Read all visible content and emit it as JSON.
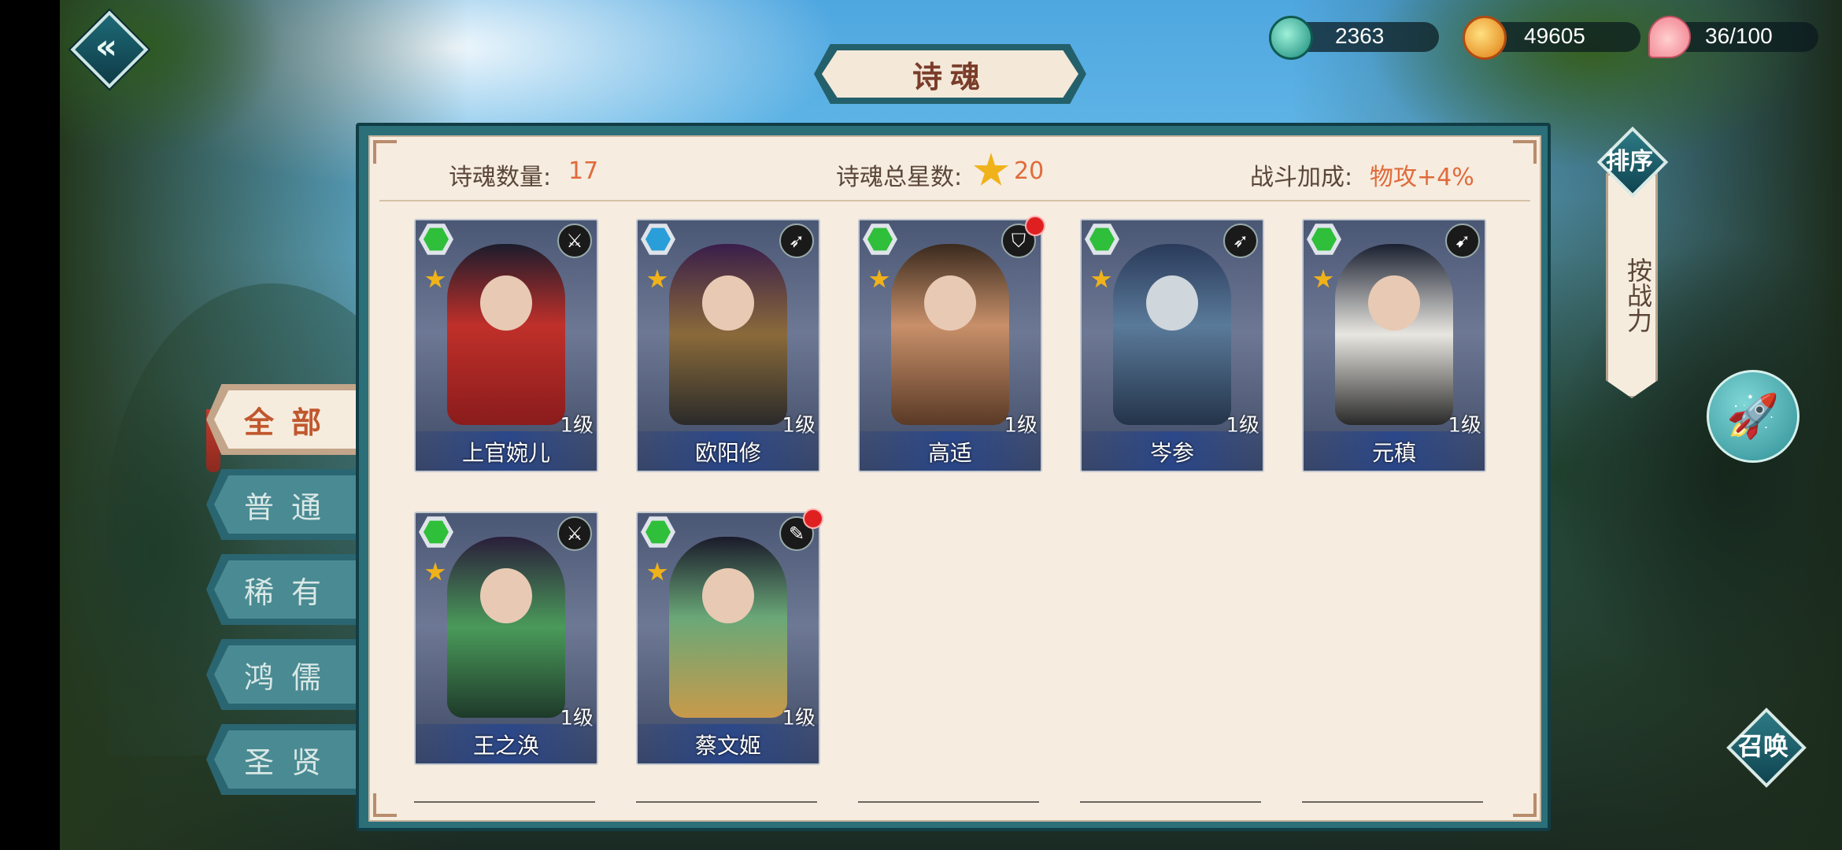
{
  "header": {
    "title": "诗魂",
    "back_icon": "chevron-left-icon",
    "resources": [
      {
        "name": "jade",
        "icon": "jade-orb-icon",
        "color": "#2fb6a0",
        "value": "2363"
      },
      {
        "name": "gold",
        "icon": "gold-coin-icon",
        "color": "#f0a020",
        "value": "49605"
      },
      {
        "name": "stamina",
        "icon": "peach-icon",
        "color": "#f2a0a8",
        "value": "36/100"
      }
    ]
  },
  "stats": {
    "count_label": "诗魂数量:",
    "count_value": "17",
    "stars_label": "诗魂总星数:",
    "stars_value": "20",
    "bonus_label": "战斗加成:",
    "bonus_value": "物攻+4%"
  },
  "tabs": [
    {
      "label": "全部",
      "active": true
    },
    {
      "label": "普通",
      "active": false
    },
    {
      "label": "稀有",
      "active": false
    },
    {
      "label": "鸿儒",
      "active": false
    },
    {
      "label": "圣贤",
      "active": false
    }
  ],
  "cards": [
    {
      "name": "上官婉儿",
      "level": "1级",
      "gem": "green",
      "class_icon": "dagger-icon",
      "red_dot": false
    },
    {
      "name": "欧阳修",
      "level": "1级",
      "gem": "blue",
      "class_icon": "spear-icon",
      "red_dot": false
    },
    {
      "name": "高适",
      "level": "1级",
      "gem": "green",
      "class_icon": "shield-icon",
      "red_dot": true
    },
    {
      "name": "岑参",
      "level": "1级",
      "gem": "green",
      "class_icon": "spear-icon",
      "red_dot": false
    },
    {
      "name": "元稹",
      "level": "1级",
      "gem": "green",
      "class_icon": "bow-icon",
      "red_dot": false
    },
    {
      "name": "王之涣",
      "level": "1级",
      "gem": "green",
      "class_icon": "dagger-icon",
      "red_dot": false
    },
    {
      "name": "蔡文姬",
      "level": "1级",
      "gem": "green",
      "class_icon": "brush-icon",
      "red_dot": true
    }
  ],
  "sort": {
    "button_label": "排序",
    "mode_label": "按战力"
  },
  "actions": {
    "rocket_icon": "rocket-icon",
    "summon_label": "召唤"
  },
  "colors": {
    "accent_orange": "#e06b3a",
    "panel_teal": "#2b6f79",
    "paper": "#f6ece0"
  }
}
